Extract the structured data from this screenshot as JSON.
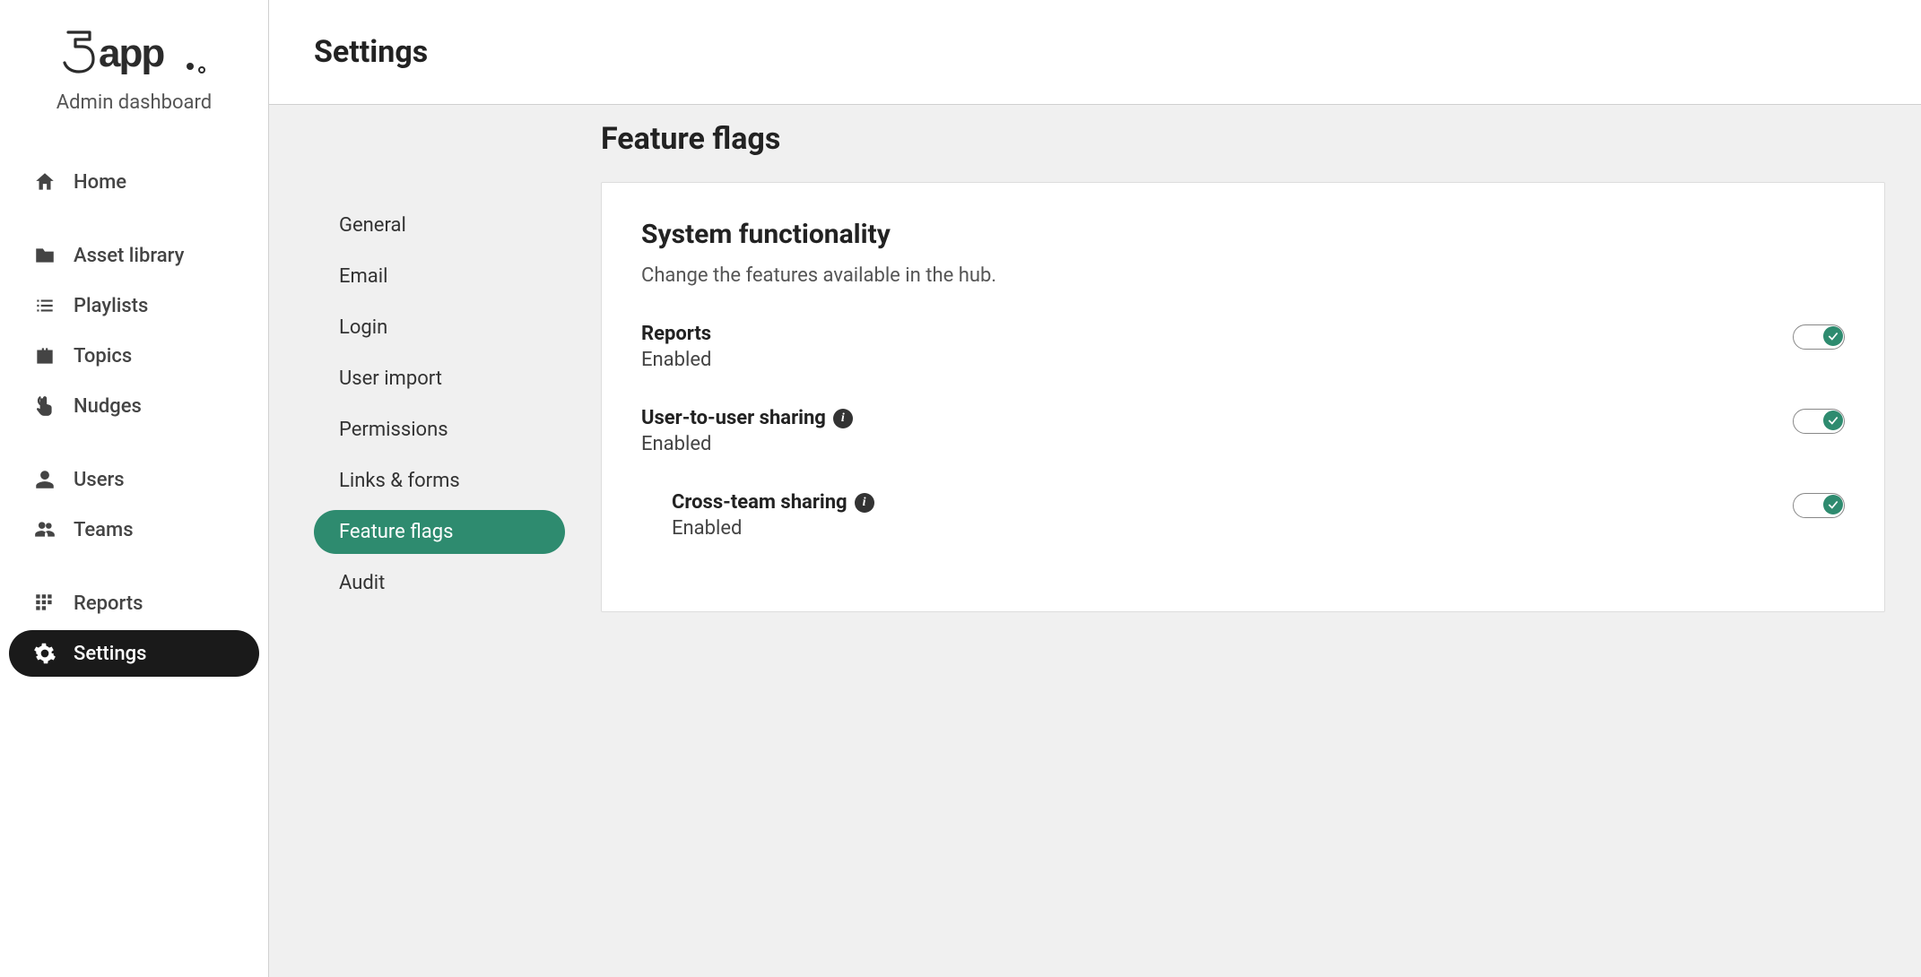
{
  "brand": {
    "logo_prefix": "5",
    "logo_text": "app.",
    "subtitle": "Admin dashboard"
  },
  "sidebar": {
    "items": [
      {
        "label": "Home",
        "icon": "home-icon",
        "active": false
      },
      {
        "label": "Asset library",
        "icon": "folder-icon",
        "active": false
      },
      {
        "label": "Playlists",
        "icon": "list-icon",
        "active": false
      },
      {
        "label": "Topics",
        "icon": "briefcase-icon",
        "active": false
      },
      {
        "label": "Nudges",
        "icon": "pointer-icon",
        "active": false
      },
      {
        "label": "Users",
        "icon": "user-icon",
        "active": false
      },
      {
        "label": "Teams",
        "icon": "users-icon",
        "active": false
      },
      {
        "label": "Reports",
        "icon": "grid-icon",
        "active": false
      },
      {
        "label": "Settings",
        "icon": "gear-icon",
        "active": true
      }
    ]
  },
  "page": {
    "title": "Settings"
  },
  "subnav": {
    "items": [
      {
        "label": "General",
        "active": false
      },
      {
        "label": "Email",
        "active": false
      },
      {
        "label": "Login",
        "active": false
      },
      {
        "label": "User import",
        "active": false
      },
      {
        "label": "Permissions",
        "active": false
      },
      {
        "label": "Links & forms",
        "active": false
      },
      {
        "label": "Feature flags",
        "active": true
      },
      {
        "label": "Audit",
        "active": false
      }
    ]
  },
  "detail": {
    "heading": "Feature flags",
    "section_title": "System functionality",
    "section_desc": "Change the features available in the hub.",
    "features": [
      {
        "label": "Reports",
        "status": "Enabled",
        "has_info": false,
        "enabled": true,
        "indented": false
      },
      {
        "label": "User-to-user sharing",
        "status": "Enabled",
        "has_info": true,
        "enabled": true,
        "indented": false
      },
      {
        "label": "Cross-team sharing",
        "status": "Enabled",
        "has_info": true,
        "enabled": true,
        "indented": true
      }
    ]
  },
  "colors": {
    "accent_green": "#2e8b6f",
    "sidebar_active": "#1a1a1a"
  }
}
